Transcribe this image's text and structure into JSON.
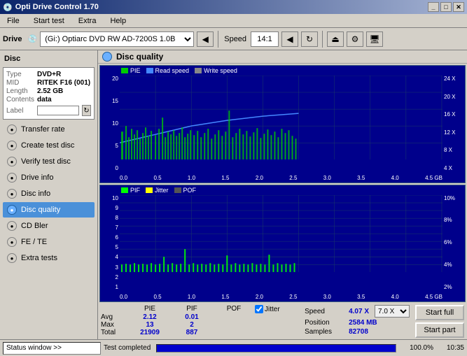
{
  "window": {
    "title": "Opti Drive Control 1.70",
    "icon": "disc-icon"
  },
  "titlebar": {
    "controls": [
      "minimize",
      "maximize",
      "close"
    ]
  },
  "menu": {
    "items": [
      "File",
      "Start test",
      "Extra",
      "Help"
    ]
  },
  "toolbar": {
    "drive_label": "Drive",
    "drive_icon": "disc-icon",
    "drive_value": "(Gi:) Optiarc DVD RW AD-7200S 1.0B",
    "speed_label": "Speed",
    "speed_value": "14:1"
  },
  "sidebar": {
    "disc_section": "Disc",
    "disc_info": {
      "type_label": "Type",
      "type_value": "DVD+R",
      "mid_label": "MID",
      "mid_value": "RITEK F16 (001)",
      "length_label": "Length",
      "length_value": "2.52 GB",
      "contents_label": "Contents",
      "contents_value": "data",
      "label_label": "Label"
    },
    "nav_items": [
      {
        "id": "transfer-rate",
        "label": "Transfer rate",
        "active": false
      },
      {
        "id": "create-test-disc",
        "label": "Create test disc",
        "active": false
      },
      {
        "id": "verify-test-disc",
        "label": "Verify test disc",
        "active": false
      },
      {
        "id": "drive-info",
        "label": "Drive info",
        "active": false
      },
      {
        "id": "disc-info",
        "label": "Disc info",
        "active": false
      },
      {
        "id": "disc-quality",
        "label": "Disc quality",
        "active": true
      },
      {
        "id": "cd-bler",
        "label": "CD Bler",
        "active": false
      },
      {
        "id": "fe-te",
        "label": "FE / TE",
        "active": false
      },
      {
        "id": "extra-tests",
        "label": "Extra tests",
        "active": false
      }
    ]
  },
  "content": {
    "title": "Disc quality",
    "chart1": {
      "legend": [
        "PIE",
        "Read speed",
        "Write speed"
      ],
      "legend_colors": [
        "#00ff00",
        "#00aaff",
        "#888888"
      ],
      "y_labels_left": [
        "20",
        "15",
        "10",
        "5",
        "0"
      ],
      "y_labels_right": [
        "24 X",
        "20 X",
        "16 X",
        "12 X",
        "8 X",
        "4 X"
      ],
      "x_labels": [
        "0.0",
        "0.5",
        "1.0",
        "1.5",
        "2.0",
        "2.5",
        "3.0",
        "3.5",
        "4.0",
        "4.5 GB"
      ]
    },
    "chart2": {
      "legend": [
        "PIF",
        "Jitter",
        "POF"
      ],
      "legend_colors": [
        "#00ff00",
        "#ffff00",
        "#888888"
      ],
      "y_labels_left": [
        "10",
        "9",
        "8",
        "7",
        "6",
        "5",
        "4",
        "3",
        "2",
        "1"
      ],
      "y_labels_right": [
        "10%",
        "8%",
        "6%",
        "4%",
        "2%"
      ],
      "x_labels": [
        "0.0",
        "0.5",
        "1.0",
        "1.5",
        "2.0",
        "2.5",
        "3.0",
        "3.5",
        "4.0",
        "4.5 GB"
      ]
    }
  },
  "stats": {
    "headers": [
      "PIE",
      "PIF",
      "POF"
    ],
    "jitter_label": "Jitter",
    "rows": [
      {
        "label": "Avg",
        "pie": "2.12",
        "pif": "0.01",
        "pof": ""
      },
      {
        "label": "Max",
        "pie": "13",
        "pif": "2",
        "pof": ""
      },
      {
        "label": "Total",
        "pie": "21909",
        "pif": "887",
        "pof": ""
      }
    ],
    "right": {
      "speed_label": "Speed",
      "speed_value": "4.07 X",
      "speed_select": "7.0 X",
      "position_label": "Position",
      "position_value": "2584 MB",
      "samples_label": "Samples",
      "samples_value": "82708"
    },
    "buttons": {
      "start_full": "Start full",
      "start_part": "Start part"
    }
  },
  "statusbar": {
    "status_button": "Status window >>",
    "progress": 100.0,
    "progress_text": "100.0%",
    "time": "10:35",
    "completed_text": "Test completed"
  },
  "colors": {
    "chart_bg": "#00008b",
    "chart_grid": "#1a3a6a",
    "pie_color": "#00cc00",
    "pif_color": "#00ff00",
    "read_speed_color": "#4488ff",
    "accent": "#0a246a",
    "active_nav": "#4a90d9"
  }
}
